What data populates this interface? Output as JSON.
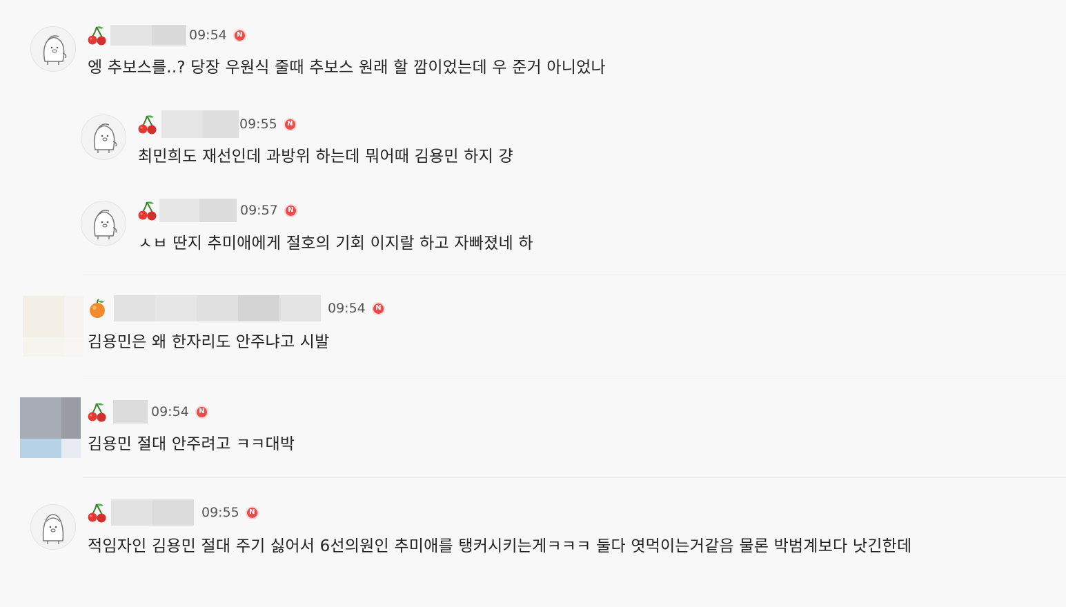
{
  "comments": [
    {
      "time": "09:54",
      "badge": "cherry-icon",
      "new_badge": "N",
      "text": "엥 추보스를..? 당장 우원식 줄때 추보스 원래 할 깜이었는데 우 준거 아니었나"
    },
    {
      "time": "09:55",
      "badge": "cherry-icon",
      "new_badge": "N",
      "text": "최민희도 재선인데 과방위 하는데 뭐어때 김용민 하지 걍"
    },
    {
      "time": "09:57",
      "badge": "cherry-icon",
      "new_badge": "N",
      "text": "ㅅㅂ 딴지 추미애에게 절호의 기회 이지랄 하고 자빠졌네 하"
    },
    {
      "time": "09:54",
      "badge": "orange-icon",
      "new_badge": "N",
      "text": "김용민은 왜 한자리도 안주냐고 시발"
    },
    {
      "time": "09:54",
      "badge": "cherry-icon",
      "new_badge": "N",
      "text": "김용민 절대 안주려고 ㅋㅋ대박"
    },
    {
      "time": "09:55",
      "badge": "cherry-icon",
      "new_badge": "N",
      "text": "적임자인 김용민 절대 주기 싫어서 6선의원인 추미애를 탱커시키는게ㅋㅋㅋ 둘다 엿먹이는거같음 물론 박범계보다 낫긴한데"
    }
  ],
  "colors": {
    "background": "#f8f8f8",
    "new_badge": "#ee4a4a",
    "text": "#222222",
    "time": "#555555"
  }
}
